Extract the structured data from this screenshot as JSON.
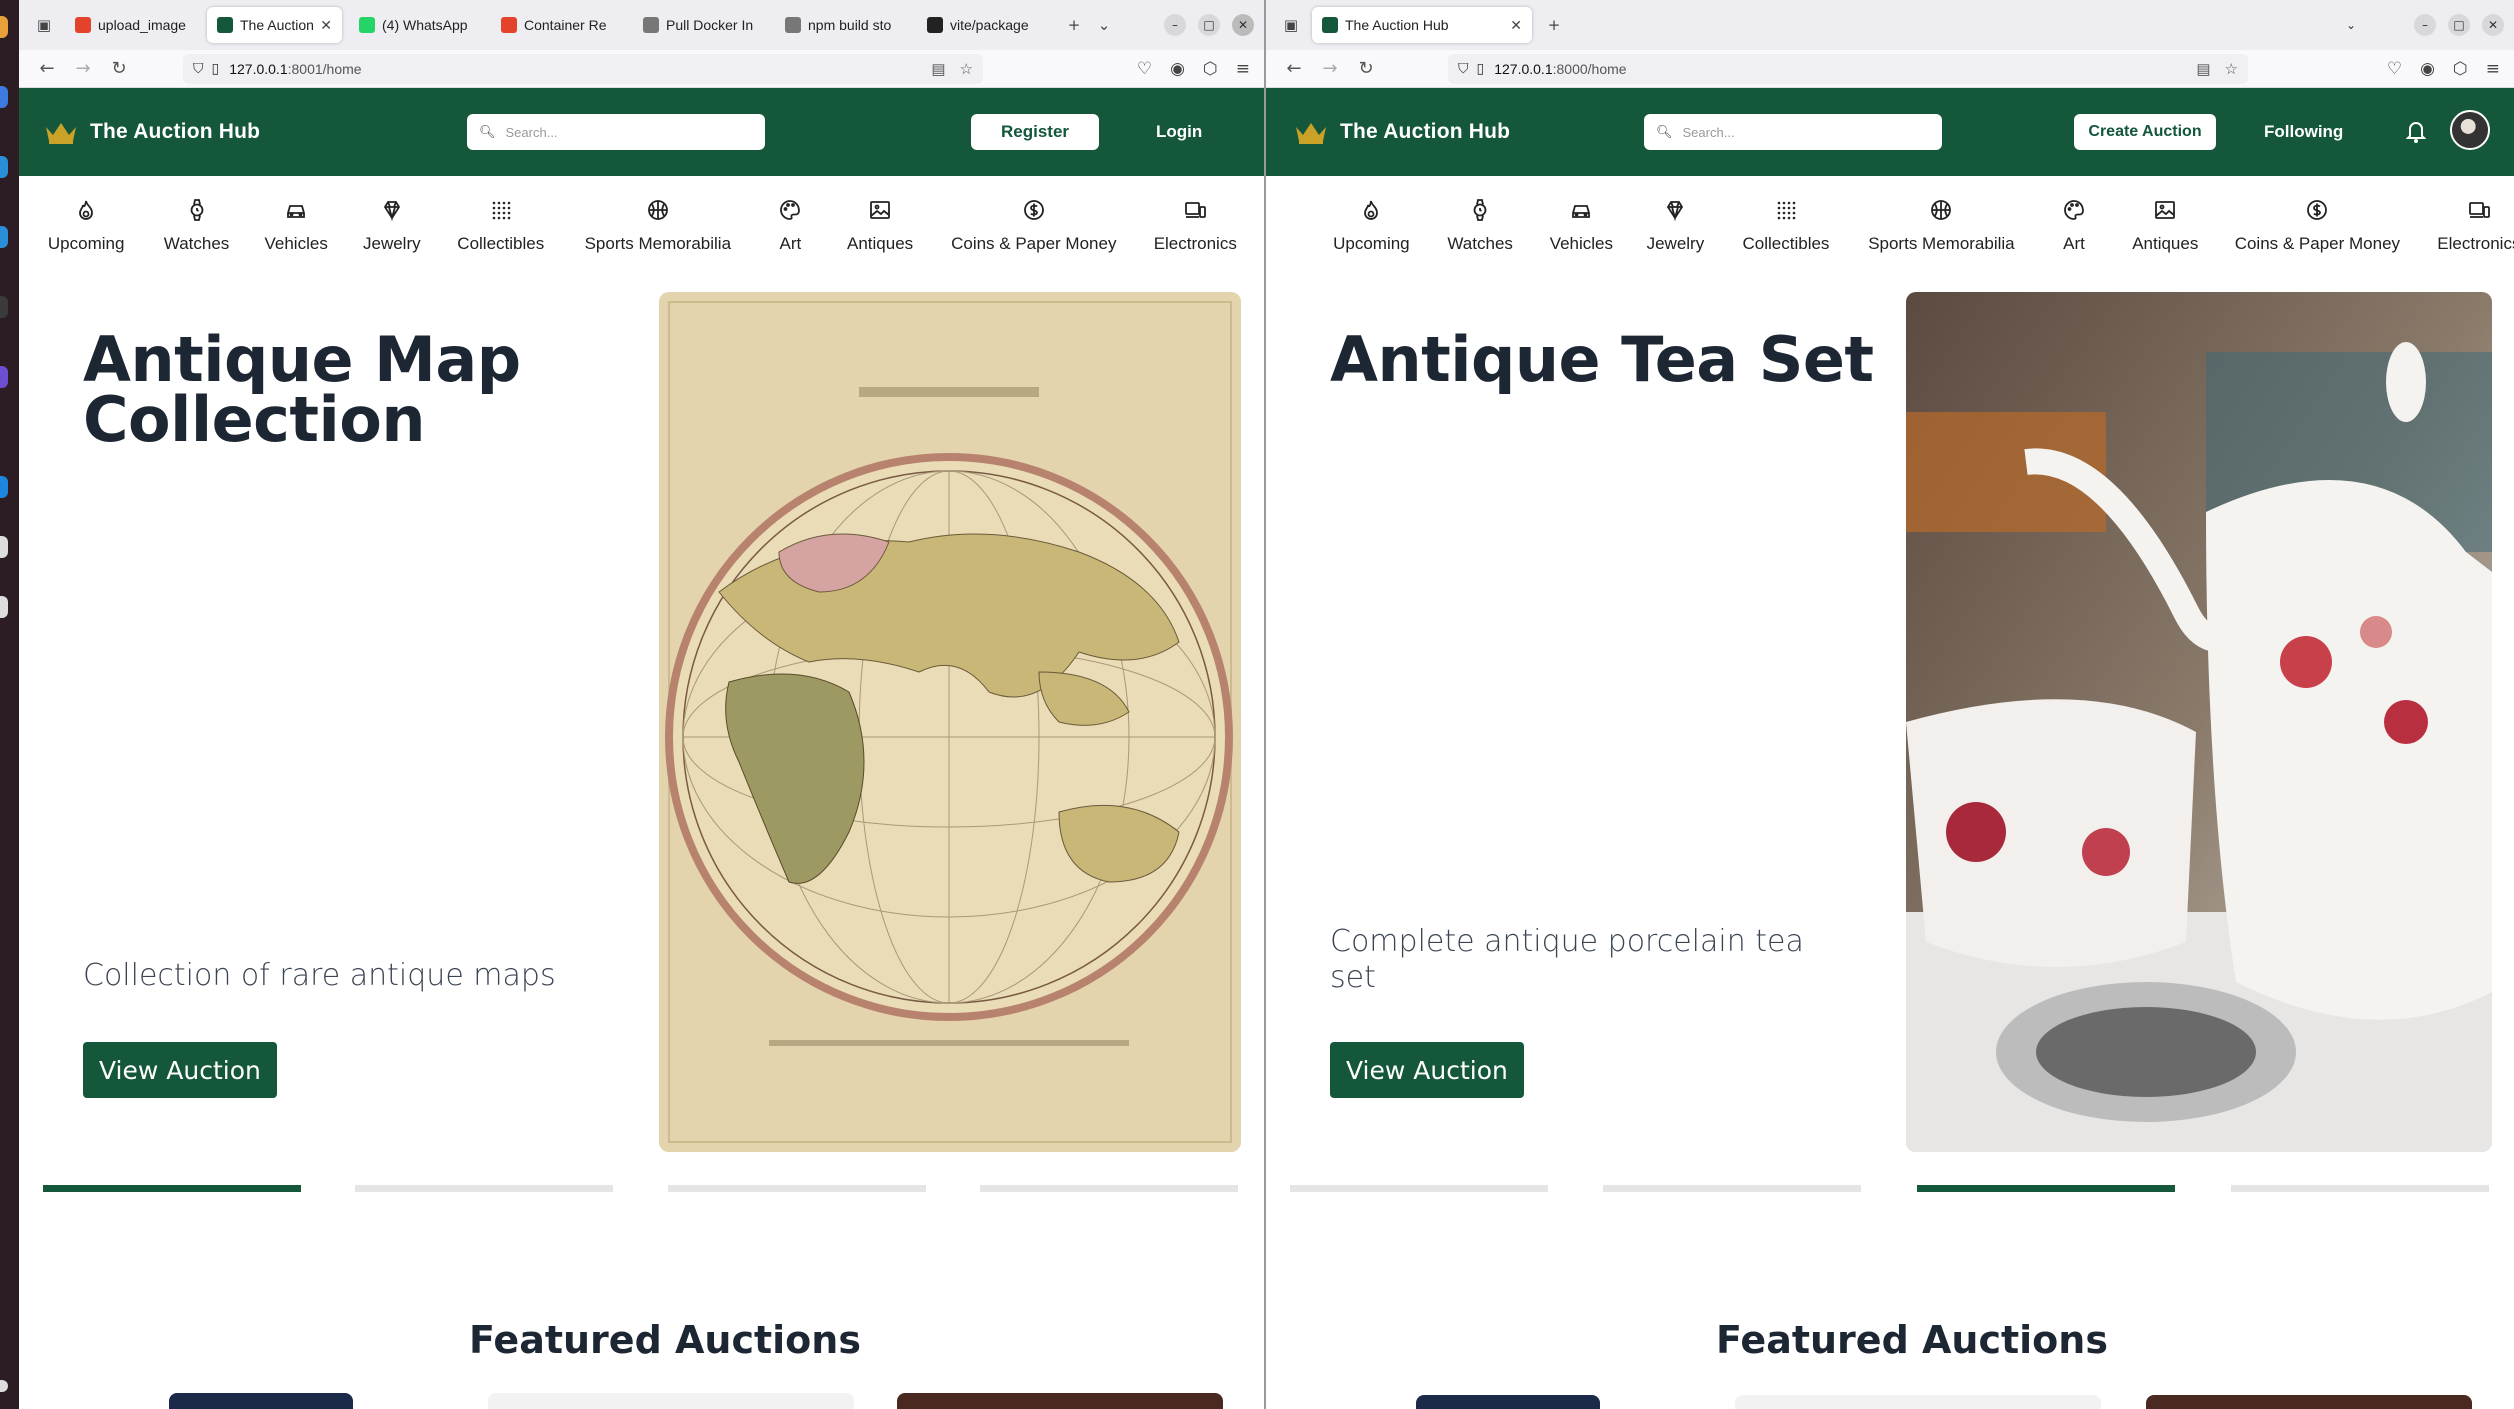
{
  "left_window": {
    "tabs": [
      {
        "label": "upload_image",
        "color": "#e2432a",
        "icon": "gitlab-icon"
      },
      {
        "label": "The Auction Hub",
        "color": "#14573a",
        "icon": "page-icon",
        "active": true
      },
      {
        "label": "(4) WhatsApp",
        "color": "#25d366",
        "icon": "whatsapp-icon"
      },
      {
        "label": "Container Re",
        "color": "#e2432a",
        "icon": "gitlab-icon"
      },
      {
        "label": "Pull Docker In",
        "color": "#777777",
        "icon": "docker-icon"
      },
      {
        "label": "npm build sto",
        "color": "#777777",
        "icon": "google-icon"
      },
      {
        "label": "vite/package",
        "color": "#222222",
        "icon": "github-icon"
      }
    ],
    "url_host": "127.0.0.1",
    "url_rest": ":8001/home",
    "header": {
      "brand": "The Auction Hub",
      "search_placeholder": "Search...",
      "register": "Register",
      "login": "Login"
    },
    "hero": {
      "title_line1": "Antique Map",
      "title_line2": "Collection",
      "description": "Collection of rare antique maps",
      "button": "View Auction",
      "active_slide": 0
    },
    "section_title": "Featured Auctions"
  },
  "right_window": {
    "tabs": [
      {
        "label": "The Auction Hub",
        "color": "#14573a",
        "icon": "page-icon",
        "active": true
      }
    ],
    "url_host": "127.0.0.1",
    "url_rest": ":8000/home",
    "header": {
      "brand": "The Auction Hub",
      "search_placeholder": "Search...",
      "create_auction": "Create Auction",
      "following": "Following"
    },
    "hero": {
      "title_line1": "Antique Tea Set",
      "description_line1": "Complete antique porcelain tea",
      "description_line2": "set",
      "button": "View Auction",
      "active_slide": 2
    },
    "section_title": "Featured Auctions"
  },
  "categories": [
    {
      "label": "Upcoming",
      "icon": "flame-icon"
    },
    {
      "label": "Watches",
      "icon": "watch-icon"
    },
    {
      "label": "Vehicles",
      "icon": "car-icon"
    },
    {
      "label": "Jewelry",
      "icon": "gem-icon"
    },
    {
      "label": "Collectibles",
      "icon": "grid-icon"
    },
    {
      "label": "Sports Memorabilia",
      "icon": "basketball-icon"
    },
    {
      "label": "Art",
      "icon": "palette-icon"
    },
    {
      "label": "Antiques",
      "icon": "image-icon"
    },
    {
      "label": "Coins & Paper Money",
      "icon": "dollar-icon"
    },
    {
      "label": "Electronics",
      "icon": "devices-icon"
    }
  ],
  "colors": {
    "brand_green": "#14573a",
    "brand_gold": "#c9a227"
  }
}
